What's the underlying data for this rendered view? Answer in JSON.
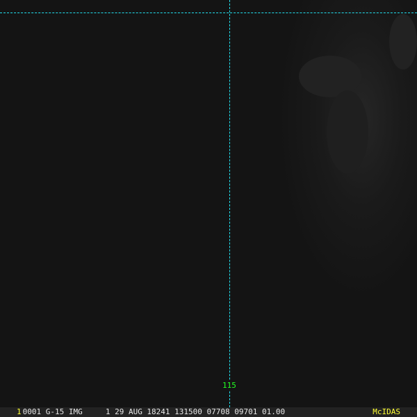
{
  "image": {
    "overlay_color": "#22e0f0",
    "longitude_label": "115",
    "longitude_label_color": "#22ff22"
  },
  "status_bar": {
    "frame_number": "1",
    "info": "0001 G-15 IMG     1 29 AUG 18241 131500 07708 09701 01.00",
    "brand": "McIDAS",
    "brand_color": "#ffff33"
  }
}
